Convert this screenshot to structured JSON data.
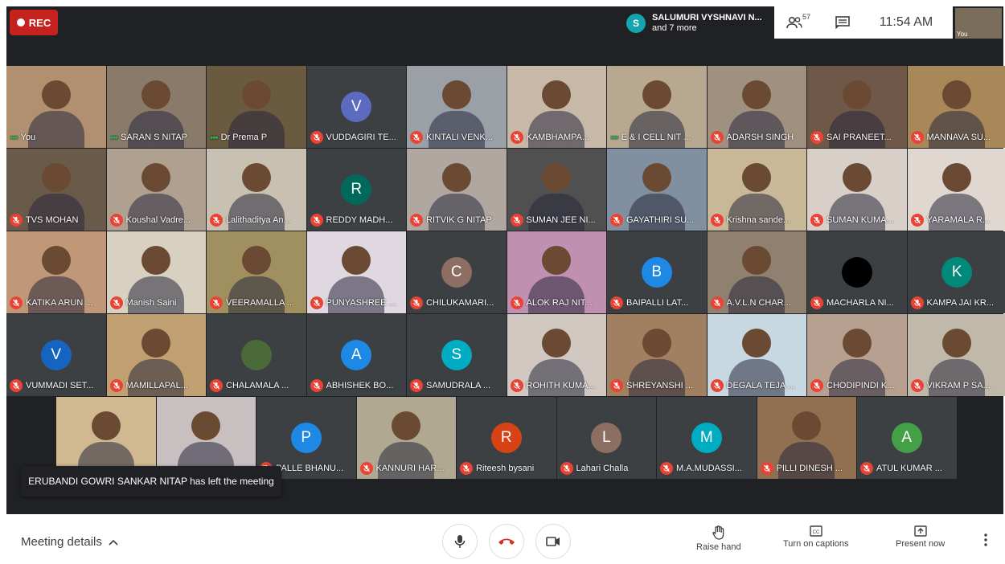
{
  "topbar": {
    "rec_label": "REC",
    "speaker_initial": "S",
    "speaker_name": "SALUMURI VYSHNAVI N...",
    "speaker_more": "and 7 more",
    "participants_count": "57",
    "time": "11:54 AM",
    "self_label": "You"
  },
  "tiles": [
    {
      "name": "You",
      "mic": "dots",
      "color": "#b09070"
    },
    {
      "name": "SARAN S NITAP",
      "mic": "dots",
      "color": "#8a7a6a"
    },
    {
      "name": "Dr Prema P",
      "mic": "dots",
      "color": "#6a5a40"
    },
    {
      "name": "VUDDAGIRI TE...",
      "mic": "muted",
      "avatar": "V",
      "avatar_color": "#5c6bc0"
    },
    {
      "name": "KINTALI VENK...",
      "mic": "muted",
      "color": "#9aa0a6"
    },
    {
      "name": "KAMBHAMPA...",
      "mic": "muted",
      "color": "#c8b8a8"
    },
    {
      "name": "E & I CELL NIT ...",
      "mic": "dots",
      "color": "#b8a890"
    },
    {
      "name": "ADARSH SINGH",
      "mic": "muted",
      "color": "#a09080"
    },
    {
      "name": "SAI PRANEET...",
      "mic": "muted",
      "color": "#705848"
    },
    {
      "name": "MANNAVA SU...",
      "mic": "muted",
      "color": "#a88858"
    },
    {
      "name": "TVS MOHAN",
      "mic": "muted",
      "color": "#6a5a4a"
    },
    {
      "name": "Koushal Vadre...",
      "mic": "muted",
      "color": "#b0a090"
    },
    {
      "name": "Lalithaditya An...",
      "mic": "muted",
      "color": "#c8c0b0"
    },
    {
      "name": "REDDY MADH...",
      "mic": "muted",
      "avatar": "R",
      "avatar_color": "#00695c"
    },
    {
      "name": "RITVIK G NITAP",
      "mic": "muted",
      "color": "#b0a8a0"
    },
    {
      "name": "SUMAN JEE NI...",
      "mic": "muted",
      "color": "#505050"
    },
    {
      "name": "GAYATHIRI SU...",
      "mic": "muted",
      "color": "#8090a0"
    },
    {
      "name": "Krishna sande...",
      "mic": "muted",
      "color": "#c8b898"
    },
    {
      "name": "SUMAN KUMA...",
      "mic": "muted",
      "color": "#d8d0c8"
    },
    {
      "name": "YARAMALA R...",
      "mic": "muted",
      "color": "#e0d8d0"
    },
    {
      "name": "KATIKA ARUN ...",
      "mic": "muted",
      "color": "#c09878"
    },
    {
      "name": "Manish Saini",
      "mic": "muted",
      "color": "#d8d0c0"
    },
    {
      "name": "VEERAMALLA ...",
      "mic": "muted",
      "color": "#a09060"
    },
    {
      "name": "PUNYASHREE ...",
      "mic": "muted",
      "color": "#e0d8e0"
    },
    {
      "name": "CHILUKAMARI...",
      "mic": "muted",
      "avatar": "C",
      "avatar_color": "#8d6e63"
    },
    {
      "name": "ALOK RAJ NIT...",
      "mic": "muted",
      "color": "#c090b0"
    },
    {
      "name": "BAIPALLI LAT...",
      "mic": "muted",
      "avatar": "B",
      "avatar_color": "#1e88e5"
    },
    {
      "name": "A.V.L.N CHAR...",
      "mic": "muted",
      "color": "#908070"
    },
    {
      "name": "MACHARLA NI...",
      "mic": "muted",
      "avatar": "",
      "avatar_color": "#000000"
    },
    {
      "name": "KAMPA JAI KR...",
      "mic": "muted",
      "avatar": "K",
      "avatar_color": "#00897b"
    },
    {
      "name": "VUMMADI SET...",
      "mic": "muted",
      "avatar": "V",
      "avatar_color": "#1565c0"
    },
    {
      "name": "MAMILLAPAL...",
      "mic": "muted",
      "color": "#c0a070"
    },
    {
      "name": "CHALAMALA ...",
      "mic": "muted",
      "avatar": "",
      "avatar_color": "#4a6a3a"
    },
    {
      "name": "ABHISHEK BO...",
      "mic": "muted",
      "avatar": "A",
      "avatar_color": "#1e88e5"
    },
    {
      "name": "SAMUDRALA ...",
      "mic": "muted",
      "avatar": "S",
      "avatar_color": "#00acc1"
    },
    {
      "name": "ROHITH KUMA...",
      "mic": "muted",
      "color": "#d0c8c0"
    },
    {
      "name": "SHREYANSHI ...",
      "mic": "muted",
      "color": "#a08060"
    },
    {
      "name": "DEGALA TEJA ...",
      "mic": "muted",
      "color": "#c8d8e0"
    },
    {
      "name": "CHODIPINDI K...",
      "mic": "muted",
      "color": "#b8a090"
    },
    {
      "name": "VIKRAM P SA...",
      "mic": "muted",
      "color": "#c0b8a8"
    },
    {
      "name": "",
      "mic": "none",
      "color": "#d0b890"
    },
    {
      "name": "",
      "mic": "none",
      "color": "#c8c0c0"
    },
    {
      "name": "PALLE BHANU...",
      "mic": "muted",
      "avatar": "P",
      "avatar_color": "#1e88e5"
    },
    {
      "name": "KANNURI HAR...",
      "mic": "muted",
      "color": "#b0a890"
    },
    {
      "name": "Riteesh bysani",
      "mic": "muted",
      "avatar": "R",
      "avatar_color": "#d84315"
    },
    {
      "name": "Lahari Challa",
      "mic": "muted",
      "avatar": "L",
      "avatar_color": "#8d6e63"
    },
    {
      "name": "M.A.MUDASSI...",
      "mic": "muted",
      "avatar": "M",
      "avatar_color": "#00acc1"
    },
    {
      "name": "PILLI DINESH ...",
      "mic": "muted",
      "color": "#907050"
    },
    {
      "name": "ATUL KUMAR ...",
      "mic": "muted",
      "avatar": "A",
      "avatar_color": "#43a047"
    }
  ],
  "toast": "ERUBANDI GOWRI SANKAR NITAP has left the meeting",
  "bottombar": {
    "meeting_details": "Meeting details",
    "raise_hand": "Raise hand",
    "captions": "Turn on captions",
    "present": "Present now"
  }
}
